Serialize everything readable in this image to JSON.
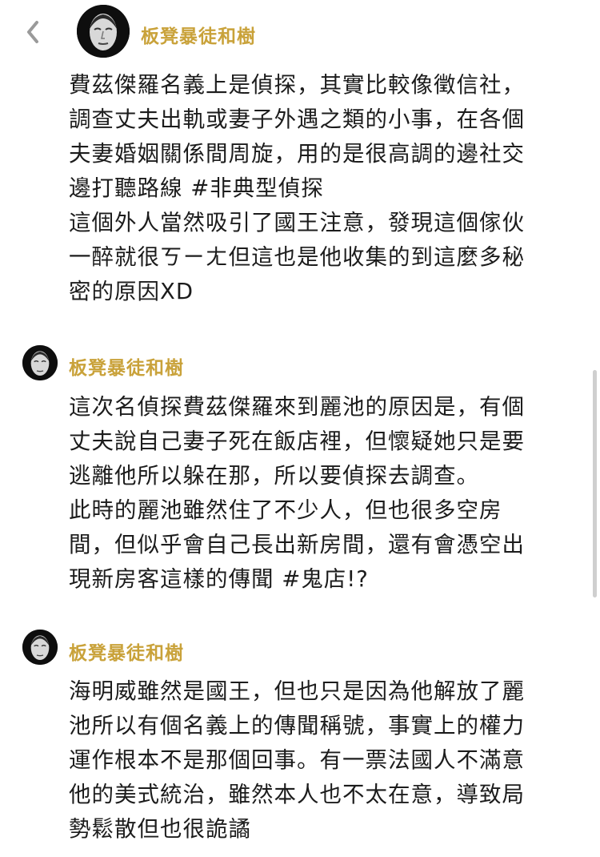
{
  "header": {
    "back_icon": "chevron-left-icon",
    "author": "板凳暴徒和樹"
  },
  "posts": [
    {
      "author": "板凳暴徒和樹",
      "lines": [
        "費茲傑羅名義上是偵探，其實比較像徵信社，",
        "調查丈夫出軌或妻子外遇之類的小事，在各個",
        "夫妻婚姻關係間周旋，用的是很高調的邊社交",
        "邊打聽路線 #非典型偵探",
        "這個外人當然吸引了國王注意，發現這個傢伙",
        "一醉就很ㄎㄧㄤ但這也是他收集的到這麼多秘",
        "密的原因XD"
      ]
    },
    {
      "author": "板凳暴徒和樹",
      "lines": [
        "這次名偵探費茲傑羅來到麗池的原因是，有個",
        "丈夫說自己妻子死在飯店裡，但懷疑她只是要",
        "逃離他所以躲在那，所以要偵探去調查。",
        "此時的麗池雖然住了不少人，但也很多空房",
        "間，但似乎會自己長出新房間，還有會憑空出",
        "現新房客這樣的傳聞 #鬼店!?"
      ]
    },
    {
      "author": "板凳暴徒和樹",
      "lines": [
        "海明威雖然是國王，但也只是因為他解放了麗",
        "池所以有個名義上的傳聞稱號，事實上的權力",
        "運作根本不是那個回事。有一票法國人不滿意",
        "他的美式統治，雖然本人也不太在意，導致局",
        "勢鬆散但也很詭譎"
      ]
    }
  ]
}
